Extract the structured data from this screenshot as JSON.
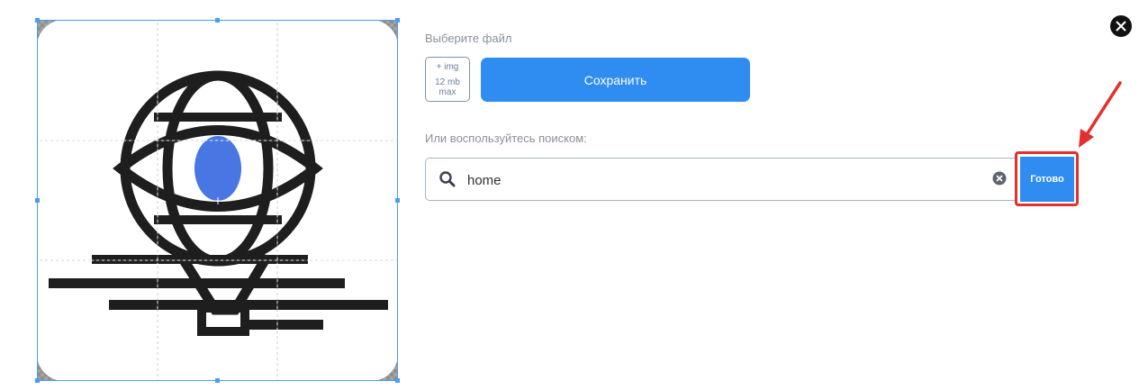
{
  "upload": {
    "section_label": "Выберите файл",
    "plus_label": "+ img",
    "size_label": "12 mb",
    "max_label": "max",
    "save_label": "Сохранить"
  },
  "search": {
    "section_label": "Или воспользуйтесь поиском:",
    "value": "home",
    "done_label": "Готово"
  },
  "preview": {
    "icon": "globe-eye-icon",
    "accent_color": "#4877e3",
    "stroke_color": "#1e1e1e"
  },
  "colors": {
    "primary": "#2f8df2",
    "highlight": "#e2302d",
    "crop_frame": "#4a9df0"
  },
  "icons": {
    "search": "search-icon",
    "clear": "clear-icon",
    "close": "close-icon",
    "annotation_arrow": "arrow-icon"
  }
}
